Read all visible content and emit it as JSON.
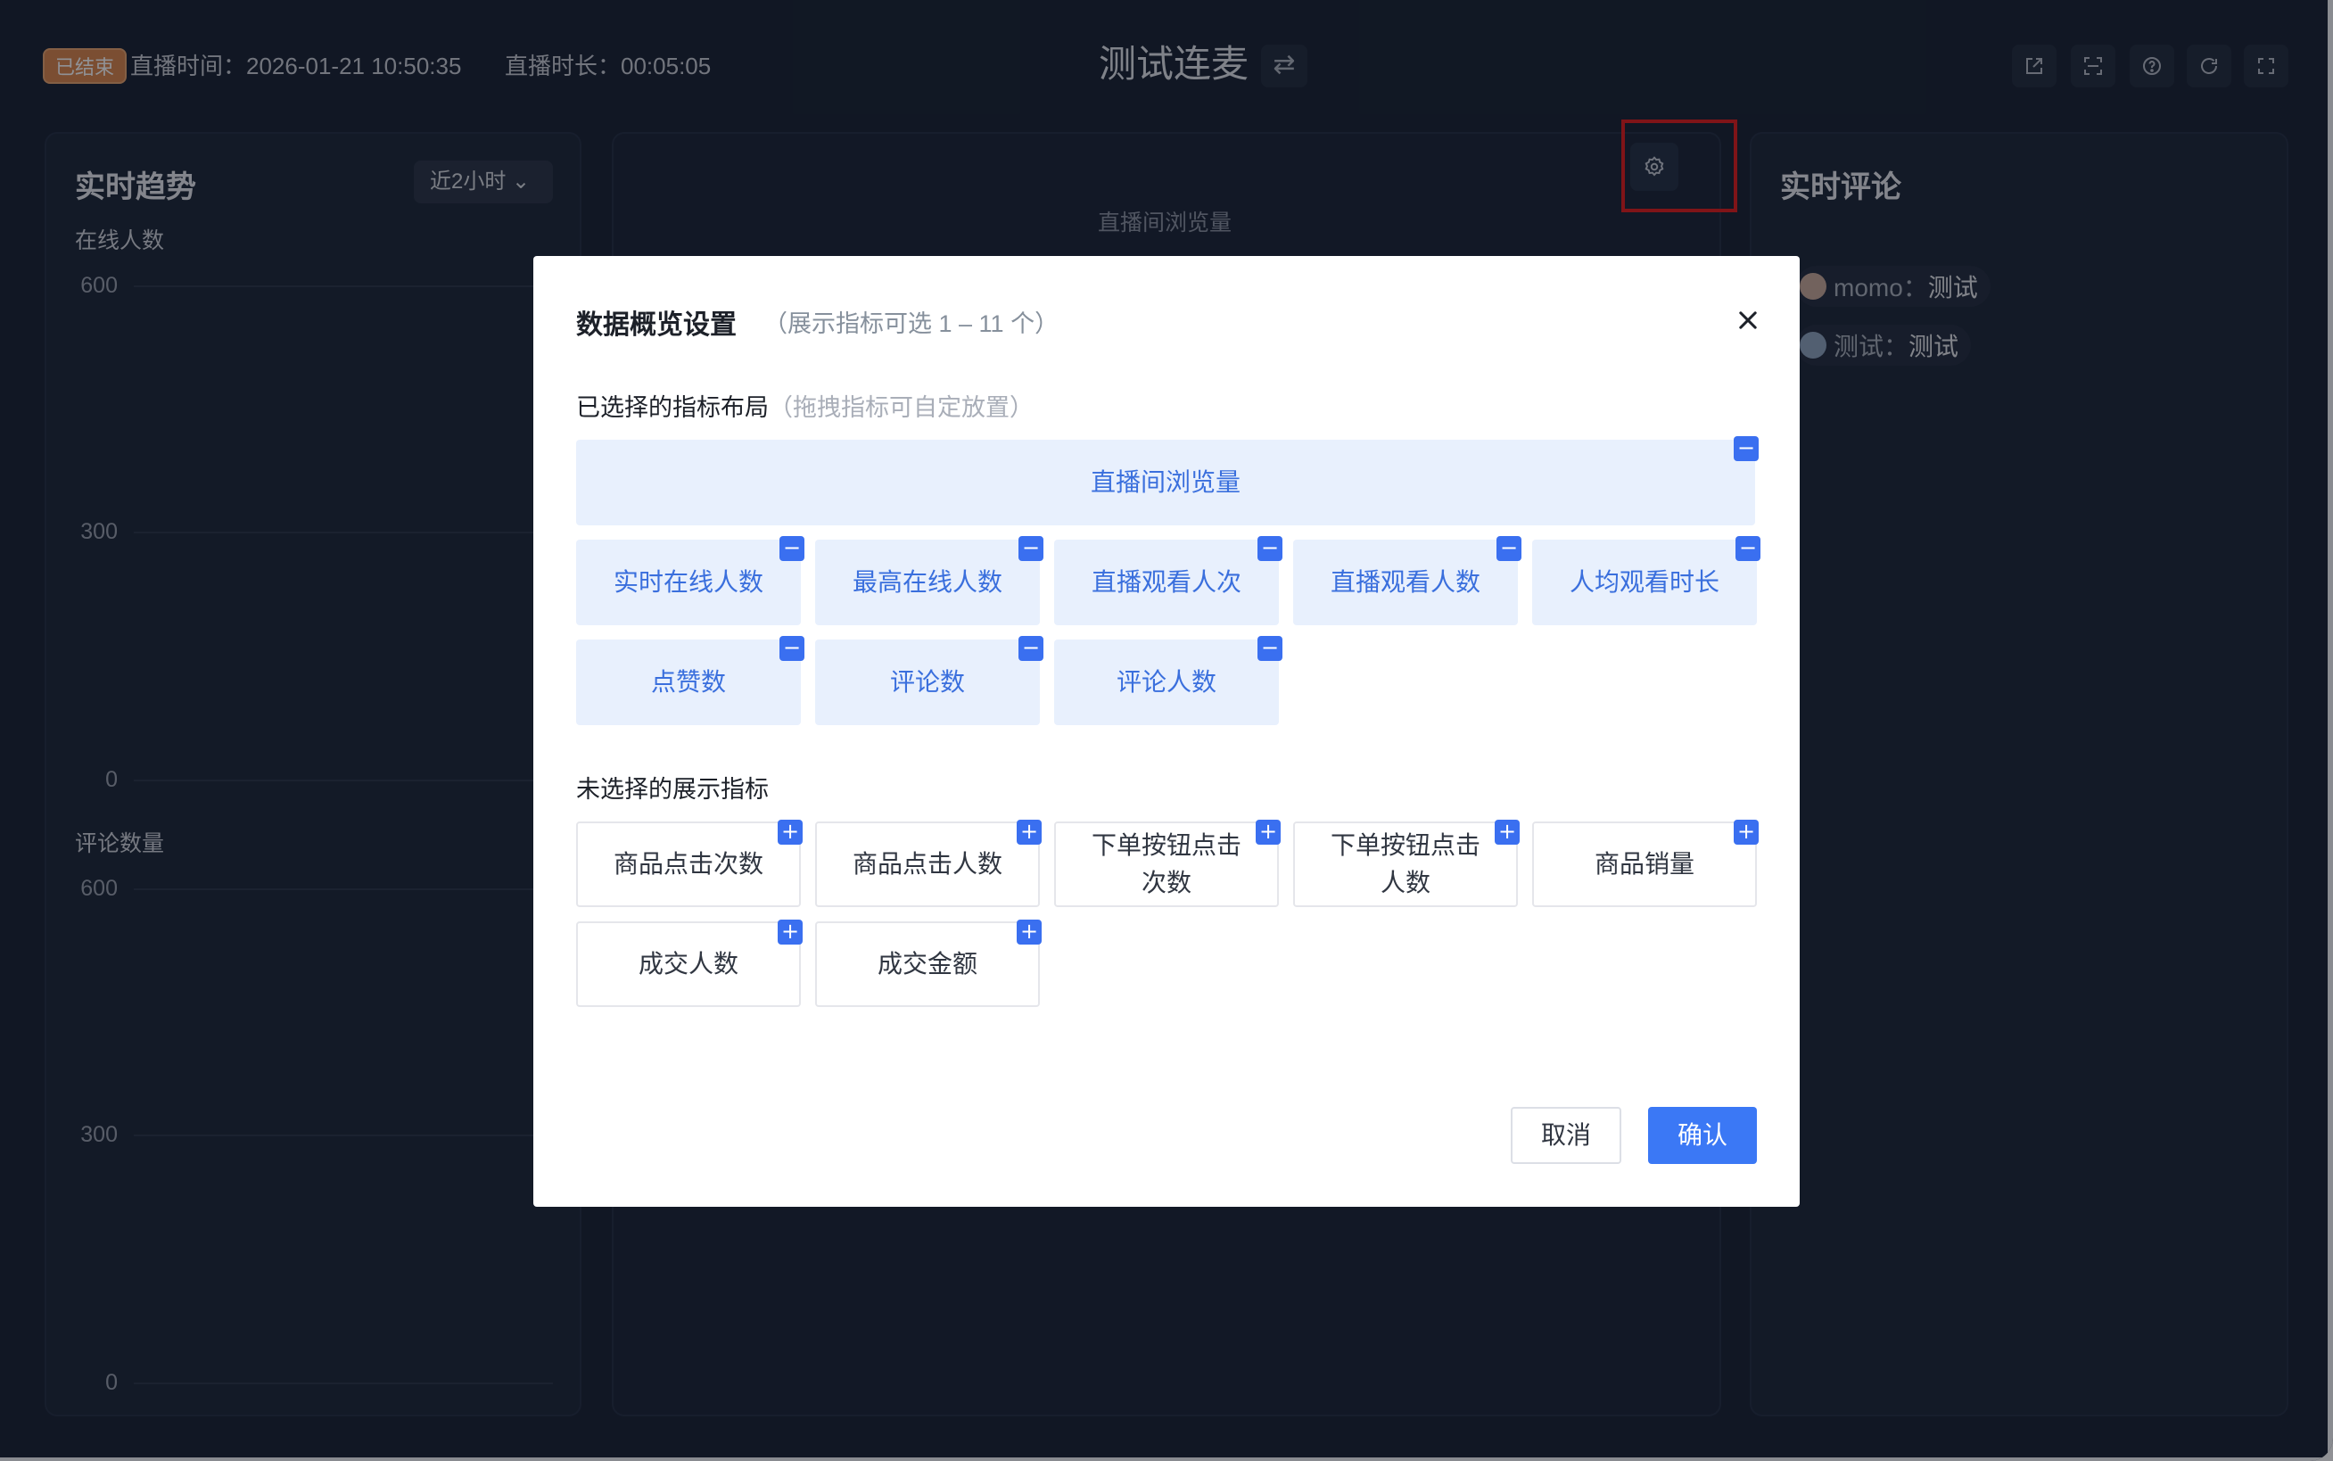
{
  "header": {
    "status_badge": "已结束",
    "live_time": "直播时间：2026-01-21 10:50:35",
    "live_duration": "直播时长：00:05:05",
    "title": "测试连麦",
    "swap_icon": "⇄"
  },
  "left_panel": {
    "title": "实时趋势",
    "range_select": "近2小时 ⌄",
    "chart1_label": "在线人数",
    "chart1_ticks": [
      "600",
      "300",
      "0"
    ],
    "chart2_label": "评论数量",
    "chart2_ticks": [
      "600",
      "300",
      "0"
    ]
  },
  "center_panel": {
    "metric_label": "直播间浏览量"
  },
  "right_panel": {
    "title": "实时评论",
    "comments": [
      {
        "user": "momo：",
        "text": "测试"
      },
      {
        "user": "测试：",
        "text": "测试"
      }
    ]
  },
  "modal": {
    "title": "数据概览设置",
    "subtitle": "（展示指标可选 1 – 11 个）",
    "selected_label": "已选择的指标布局",
    "selected_hint": "（拖拽指标可自定放置）",
    "selected_tiles": [
      "直播间浏览量",
      "实时在线人数",
      "最高在线人数",
      "直播观看人次",
      "直播观看人数",
      "人均观看时长",
      "点赞数",
      "评论数",
      "评论人数"
    ],
    "unselected_label": "未选择的展示指标",
    "unselected_tiles": [
      "商品点击次数",
      "商品点击人数",
      "下单按钮点击次数",
      "下单按钮点击人数",
      "商品销量",
      "成交人数",
      "成交金额"
    ],
    "unselected_display": [
      "商品点击次数",
      "商品点击人数",
      "下单按钮点击\n次数",
      "下单按钮点击\n人数",
      "商品销量",
      "成交人数",
      "成交金额"
    ],
    "remove_symbol": "−",
    "add_symbol": "+",
    "cancel_label": "取消",
    "confirm_label": "确认"
  }
}
